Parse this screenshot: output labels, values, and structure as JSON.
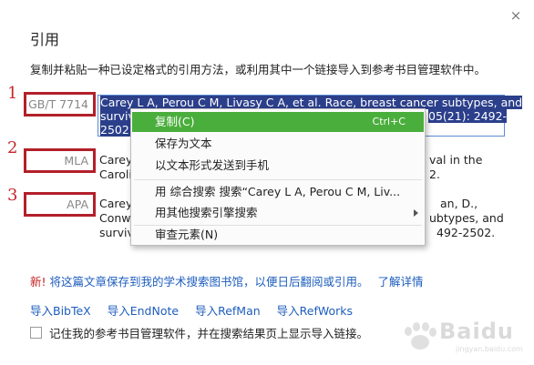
{
  "dialog": {
    "title": "引用",
    "instruction": "复制并粘贴一种已设定格式的引用方法，或利用其中一个链接导入到参考书目管理软件中。",
    "close_glyph": "×"
  },
  "markers": [
    "1",
    "2",
    "3"
  ],
  "formats": [
    {
      "name": "GB/T 7714",
      "lines": [
        "Carey L A, Perou C M, Livasy C A, et al. Race, breast cancer subtypes, and",
        "surviva",
        "2502."
      ],
      "line_right_fragment": "05(21): 2492-"
    },
    {
      "name": "MLA",
      "lines": [
        "Carey,",
        "Carolin"
      ],
      "right_fragments": [
        "val in the",
        "2."
      ]
    },
    {
      "name": "APA",
      "lines": [
        "Carey,",
        "Conwa",
        "surviva"
      ],
      "right_fragments": [
        "an, D.,",
        "ubtypes, and",
        "492-2502."
      ]
    }
  ],
  "context_menu": {
    "items": [
      {
        "label": "复制(C)",
        "shortcut": "Ctrl+C"
      },
      {
        "label": "保存为文本"
      },
      {
        "label": "以文本形式发送到手机"
      },
      {
        "label": "用 综合搜索 搜索“Carey L A, Perou C M, Liv..."
      },
      {
        "label": "用其他搜索引擎搜索"
      },
      {
        "label": "审查元素(N)"
      }
    ]
  },
  "footer": {
    "new_badge": "新!",
    "save_text": "将这篇文章保存到我的学术搜索图书馆，以便日后翻阅或引用。",
    "learn_more": "了解详情",
    "import_links": [
      "导入BibTeX",
      "导入EndNote",
      "导入RefMan",
      "导入RefWorks"
    ],
    "remember_label": "记住我的参考书目管理软件，并在搜索结果页上显示导入链接。"
  },
  "watermark": {
    "text": "Baidu",
    "sub": "jingyan.baidu.com"
  },
  "colors": {
    "accent_link": "#1d5dbd",
    "marker_red": "#b3202a",
    "menu_highlight": "#4aae3c",
    "selection": "#2b3f8b"
  }
}
